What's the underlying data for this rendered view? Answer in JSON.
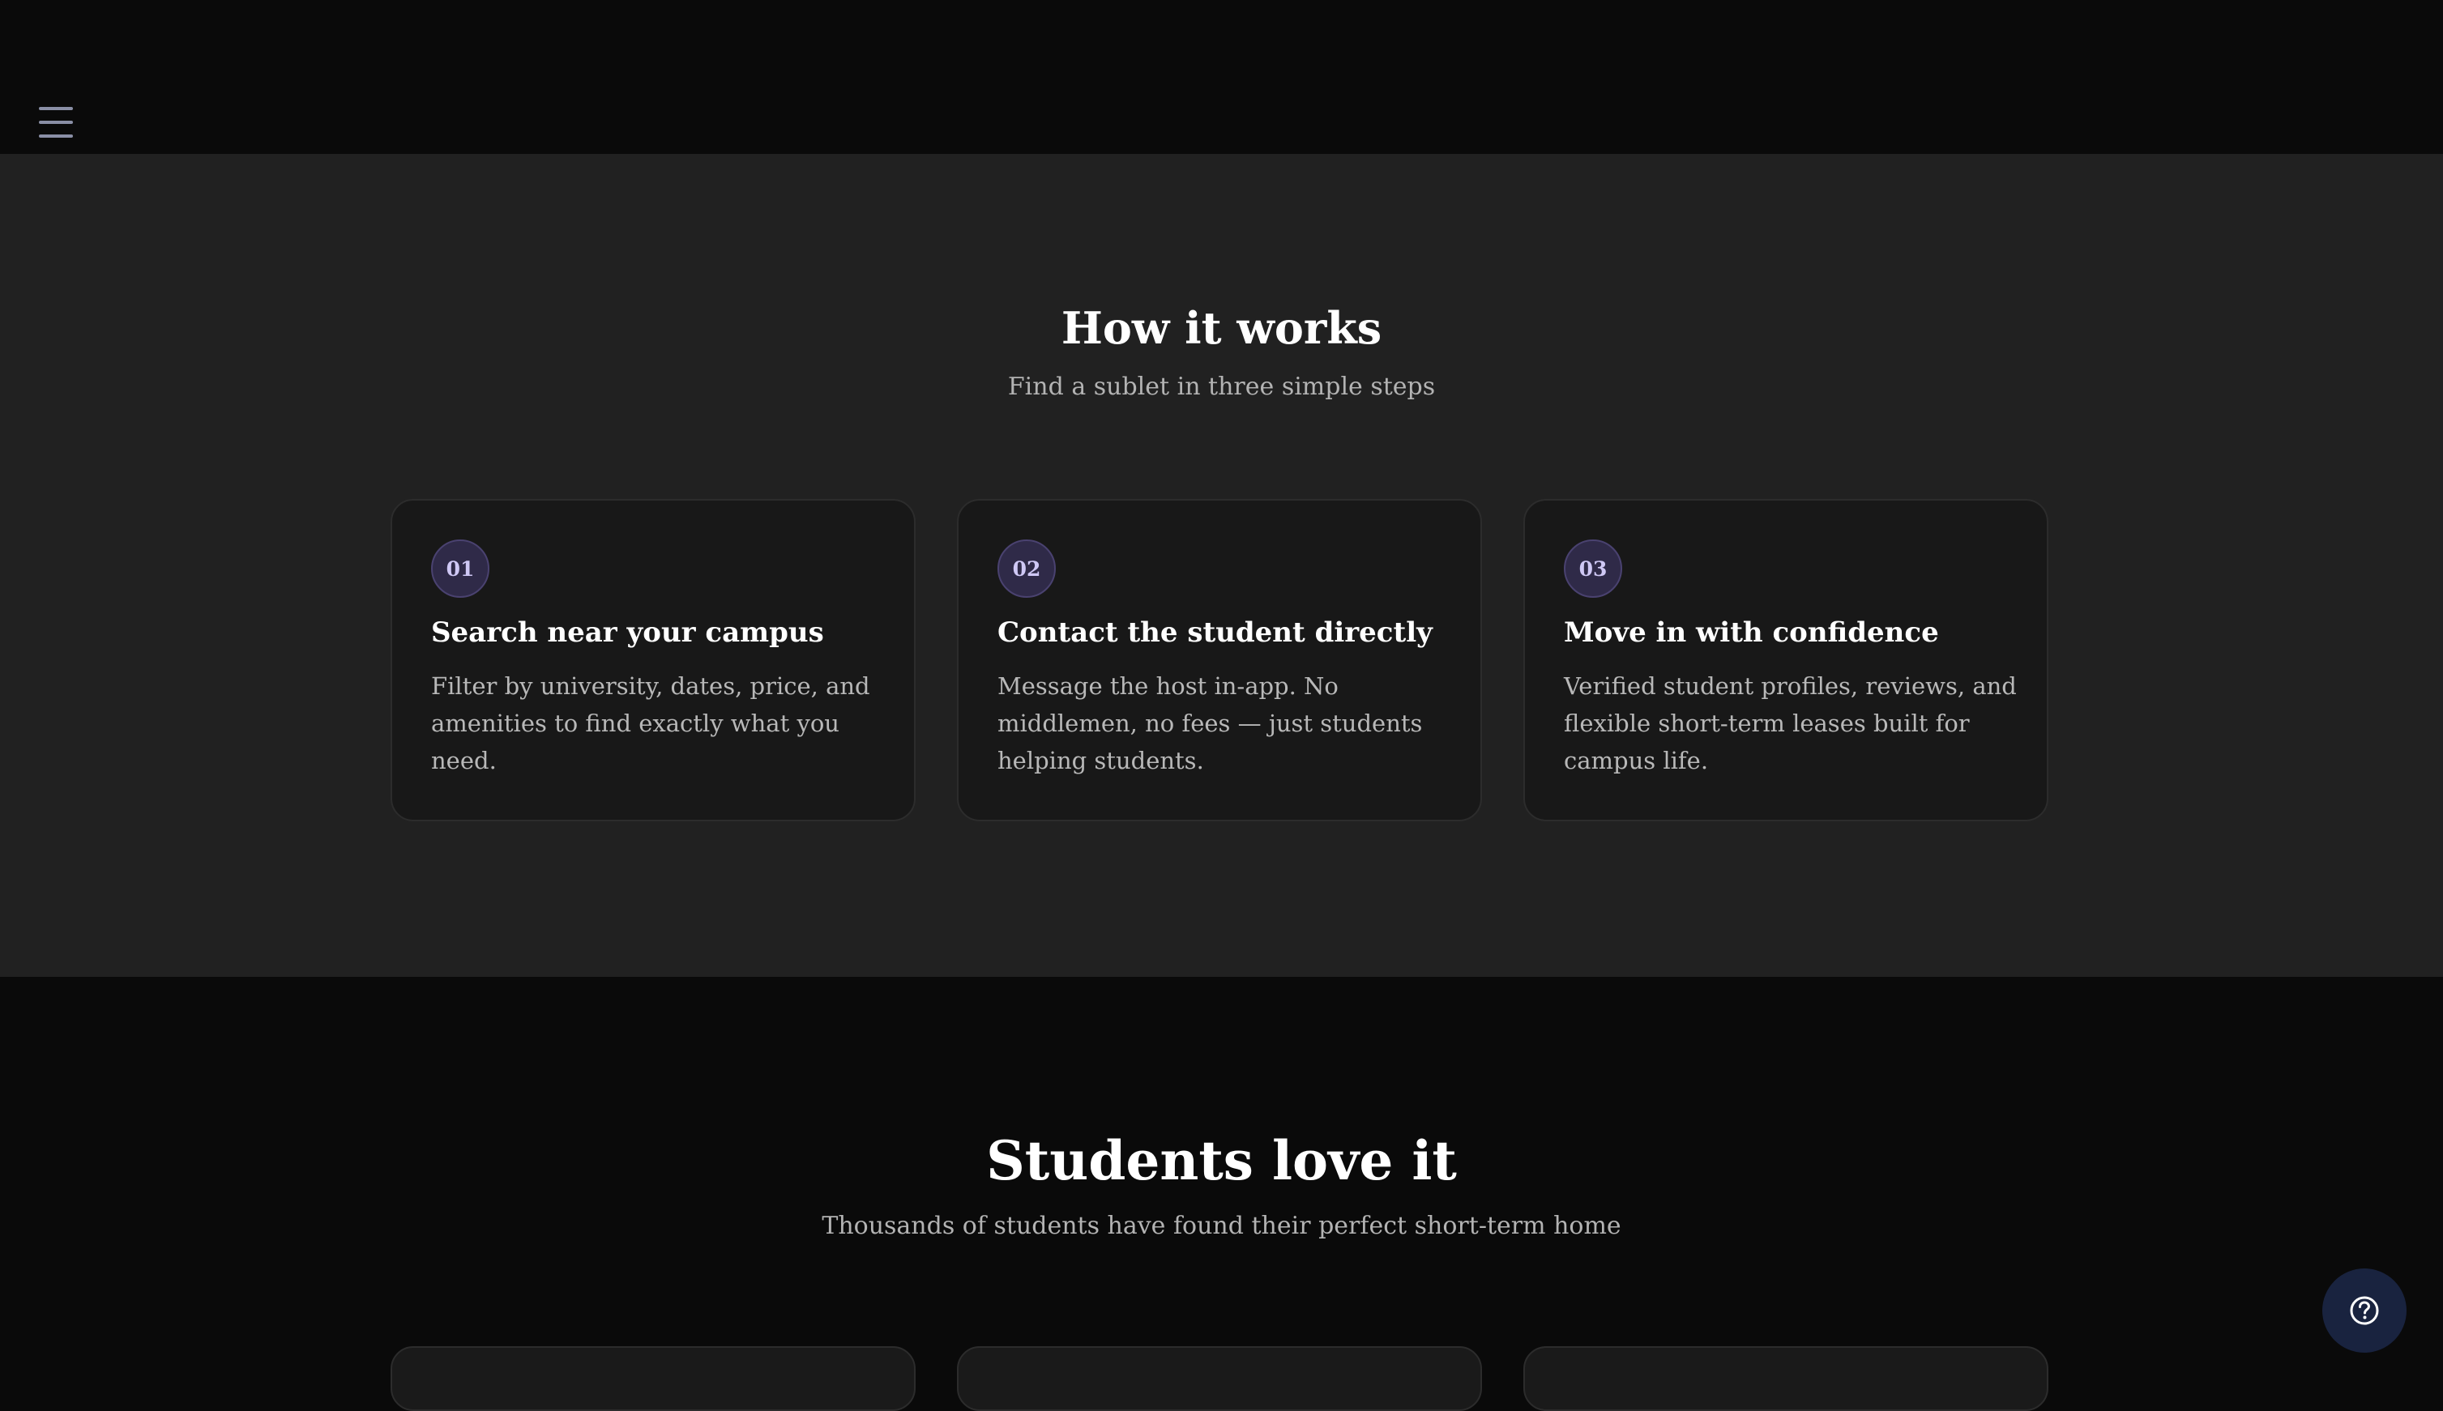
{
  "header": {
    "menu_icon": "hamburger-menu-icon"
  },
  "how_it_works": {
    "title": "How it works",
    "subtitle": "Find a sublet in three simple steps",
    "steps": [
      {
        "number": "01",
        "title": "Search near your campus",
        "description": "Filter by university, dates, price, and amenities to find exactly what you need."
      },
      {
        "number": "02",
        "title": "Contact the student directly",
        "description": "Message the host in-app. No middlemen, no fees — just students helping students."
      },
      {
        "number": "03",
        "title": "Move in with confidence",
        "description": "Verified student profiles, reviews, and flexible short-term leases built for campus life."
      }
    ]
  },
  "testimonials": {
    "title": "Students love it",
    "subtitle": "Thousands of students have found their perfect short-term home"
  },
  "help": {
    "icon": "help-circle-icon"
  },
  "colors": {
    "page_bg": "#0a0a0a",
    "section_bg": "#212121",
    "card_bg": "#181818",
    "step_badge_bg": "#2f2a48",
    "step_badge_text": "#cfc8f5",
    "help_button_bg": "#19233f"
  }
}
